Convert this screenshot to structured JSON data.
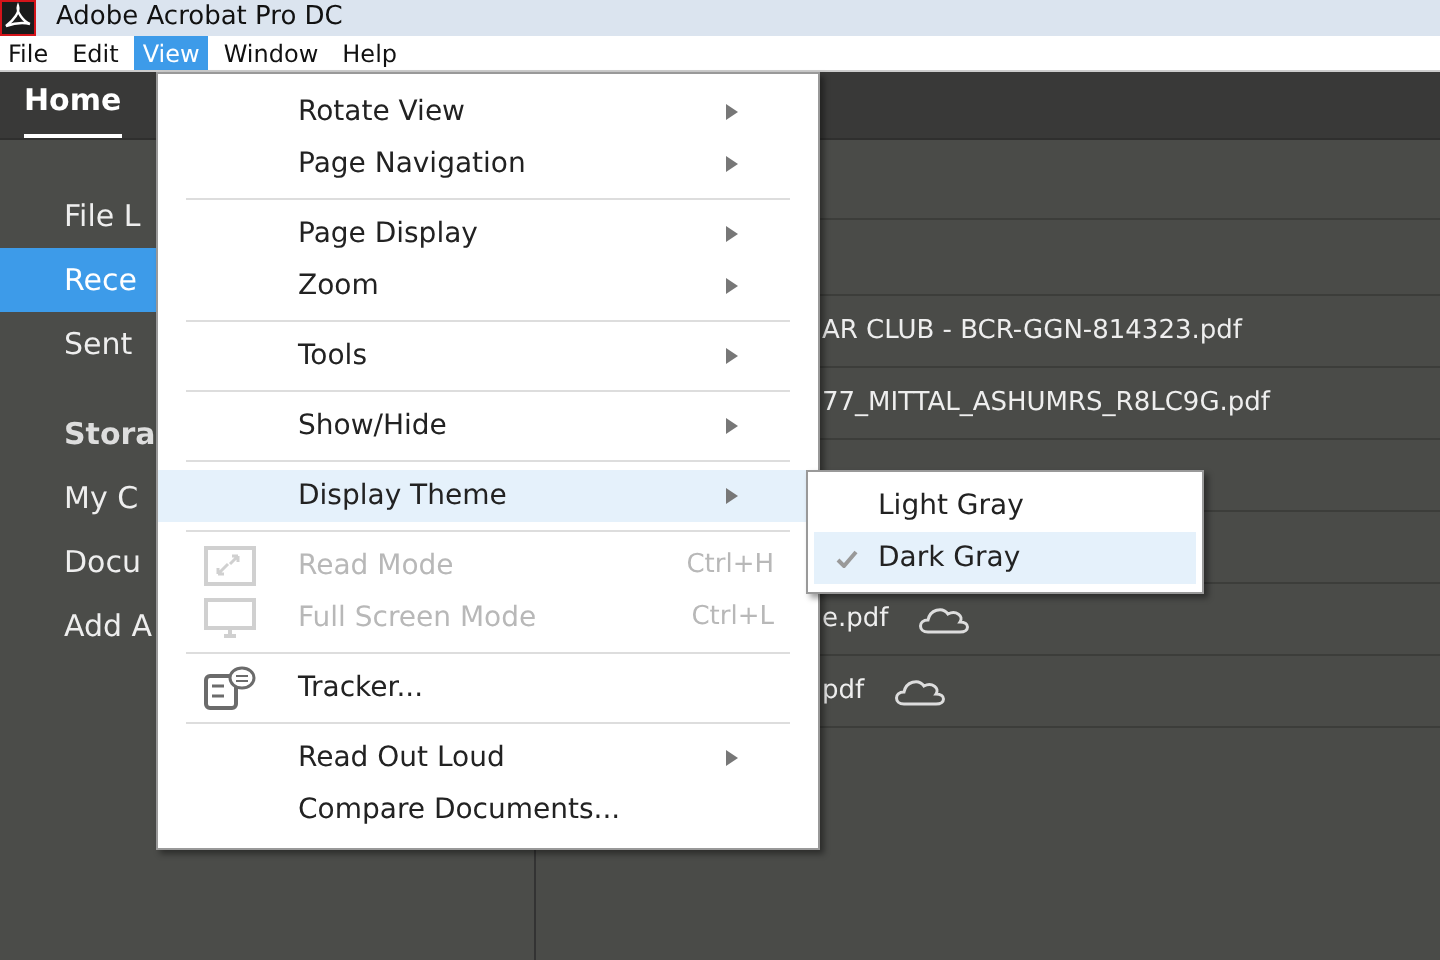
{
  "window": {
    "title": "Adobe Acrobat Pro DC"
  },
  "menu_bar": [
    {
      "label": "File",
      "selected": false
    },
    {
      "label": "Edit",
      "selected": false
    },
    {
      "label": "View",
      "selected": true
    },
    {
      "label": "Window",
      "selected": false
    },
    {
      "label": "Help",
      "selected": false
    }
  ],
  "tabs": [
    {
      "label": "Home",
      "selected": true
    }
  ],
  "sidebar": {
    "items": [
      {
        "label": "File L",
        "selected": false,
        "kind": "item"
      },
      {
        "label": "Rece",
        "selected": true,
        "kind": "item"
      },
      {
        "label": "Sent",
        "selected": false,
        "kind": "item"
      },
      {
        "label": "Stora",
        "selected": false,
        "kind": "heading"
      },
      {
        "label": "My C",
        "selected": false,
        "kind": "item"
      },
      {
        "label": "Docu",
        "selected": false,
        "kind": "item"
      },
      {
        "label": "Add A",
        "selected": false,
        "kind": "item"
      }
    ]
  },
  "files": [
    {
      "name": "AR CLUB - BCR-GGN-814323.pdf",
      "cloud": false
    },
    {
      "name": "77_MITTAL_ASHUMRS_R8LC9G.pdf",
      "cloud": false
    },
    {
      "cloud": false
    },
    {
      "cloud": false
    },
    {
      "name": "e.pdf",
      "cloud": true
    },
    {
      "name": "pdf",
      "cloud": true
    }
  ],
  "view_menu": [
    {
      "kind": "item",
      "label": "Rotate View",
      "submenu": true,
      "disabled": false,
      "selected": false
    },
    {
      "kind": "item",
      "label": "Page Navigation",
      "submenu": true,
      "disabled": false,
      "selected": false
    },
    {
      "kind": "separator"
    },
    {
      "kind": "item",
      "label": "Page Display",
      "submenu": true,
      "disabled": false,
      "selected": false
    },
    {
      "kind": "item",
      "label": "Zoom",
      "submenu": true,
      "disabled": false,
      "selected": false
    },
    {
      "kind": "separator"
    },
    {
      "kind": "item",
      "label": "Tools",
      "submenu": true,
      "disabled": false,
      "selected": false
    },
    {
      "kind": "separator"
    },
    {
      "kind": "item",
      "label": "Show/Hide",
      "submenu": true,
      "disabled": false,
      "selected": false
    },
    {
      "kind": "separator"
    },
    {
      "kind": "item",
      "label": "Display Theme",
      "submenu": true,
      "disabled": false,
      "selected": true
    },
    {
      "kind": "separator"
    },
    {
      "kind": "expand",
      "label": "Read Mode",
      "shortcut": "Ctrl+H",
      "submenu": false,
      "disabled": true,
      "selected": false
    },
    {
      "kind": "monitor",
      "label": "Full Screen Mode",
      "shortcut": "Ctrl+L",
      "submenu": false,
      "disabled": true,
      "selected": false
    },
    {
      "kind": "separator"
    },
    {
      "kind": "tracker",
      "label": "Tracker...",
      "submenu": false,
      "disabled": false,
      "selected": false
    },
    {
      "kind": "separator"
    },
    {
      "kind": "item",
      "label": "Read Out Loud",
      "submenu": true,
      "disabled": false,
      "selected": false
    },
    {
      "kind": "item",
      "label": "Compare Documents...",
      "submenu": false,
      "disabled": false,
      "selected": false
    }
  ],
  "theme_submenu": [
    {
      "label": "Light Gray",
      "checked": false,
      "selected": false
    },
    {
      "label": "Dark Gray",
      "checked": true,
      "selected": true
    }
  ]
}
